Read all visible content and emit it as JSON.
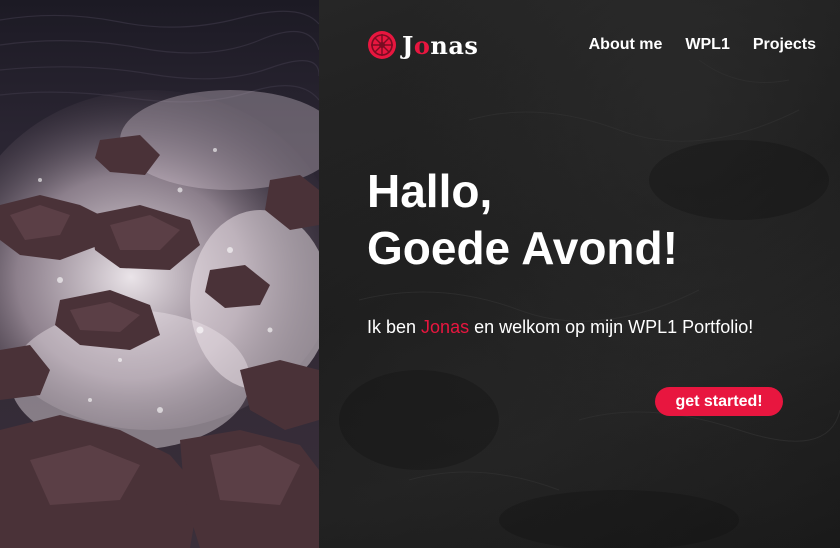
{
  "brand": {
    "logo_icon": "logo-icon",
    "name_prefix": "J",
    "name_accent": "o",
    "name_suffix": "nas",
    "accent_color": "#e8163f"
  },
  "nav": {
    "items": [
      {
        "label": "About me"
      },
      {
        "label": "WPL1"
      },
      {
        "label": "Projects"
      }
    ]
  },
  "hero": {
    "title_line1": "Hallo,",
    "title_line2": "Goede Avond!",
    "intro_before": "Ik ben ",
    "intro_name": "Jonas",
    "intro_after": " en welkom op mijn WPL1 Portfolio!",
    "cta_label": "get started!"
  },
  "colors": {
    "background": "#161616",
    "text": "#ffffff",
    "accent": "#e8163f"
  }
}
